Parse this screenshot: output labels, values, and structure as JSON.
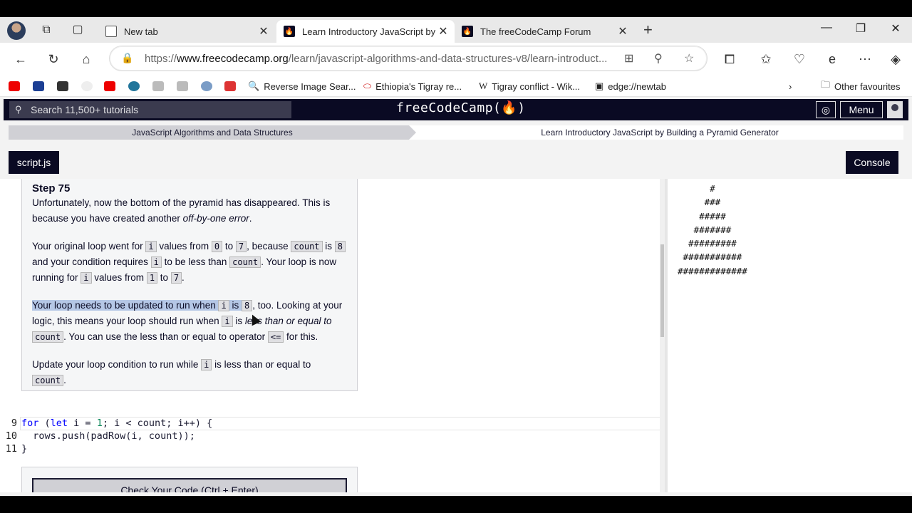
{
  "browser": {
    "tabs": [
      {
        "title": "New tab",
        "active": false
      },
      {
        "title": "Learn Introductory JavaScript by E",
        "active": true
      },
      {
        "title": "The freeCodeCamp Forum",
        "active": false
      }
    ],
    "url_prefix": "https://",
    "url_host": "www.freecodecamp.org",
    "url_path": "/learn/javascript-algorithms-and-data-structures-v8/learn-introduct...",
    "favourites": [
      {
        "label": "Reverse Image Sear...",
        "icon": "search-icon"
      },
      {
        "label": "Ethiopia's Tigray re...",
        "icon": "news-icon"
      },
      {
        "label": "Tigray conflict - Wik...",
        "icon": "wikipedia-icon"
      },
      {
        "label": "edge://newtab",
        "icon": "newtab-icon"
      }
    ],
    "other_favourites": "Other favourites",
    "colors": {
      "tab_strip": "#e9e9e9",
      "active_tab": "#ffffff"
    }
  },
  "fcc": {
    "search_placeholder": "Search 11,500+ tutorials",
    "logo": "freeCodeCamp(🔥)",
    "menu_label": "Menu",
    "breadcrumb_1": "JavaScript Algorithms and Data Structures",
    "breadcrumb_2": "Learn Introductory JavaScript by Building a Pyramid Generator",
    "file_tab": "script.js",
    "console_tab": "Console",
    "check_button": "Check Your Code (Ctrl + Enter)",
    "colors": {
      "nav": "#0a0a23",
      "panel": "#f5f6f7",
      "highlight": "#b5c7e6"
    }
  },
  "instructions": {
    "step_title": "Step 75",
    "p1_a": "Unfortunately, now the bottom of the pyramid has disappeared. This is because you have created another ",
    "p1_em": "off-by-one error",
    "p1_b": ".",
    "p2_a": "Your original loop went for ",
    "p2_b": " values from ",
    "p2_c": " to ",
    "p2_d": ", because ",
    "p2_e": " is ",
    "p2_f": " and your condition requires ",
    "p2_g": " to be less than ",
    "p2_h": ". Your loop is now running for ",
    "p2_i": " values from ",
    "p2_j": " to ",
    "p2_k": ".",
    "p3_hl": "Your loop needs to be updated to run when ",
    "p3_is": " is ",
    "p3_a": ", too. Looking at your logic, this means your loop should run when ",
    "p3_b": " is ",
    "p3_em": "less than or equal to",
    "p3_c": ". You can use the less than or equal to operator ",
    "p3_d": " for this.",
    "p4_a": "Update your loop condition to run while ",
    "p4_b": " is less than or equal to ",
    "p4_c": ".",
    "code_i": "i",
    "code_0": "0",
    "code_7": "7",
    "code_count": "count",
    "code_8": "8",
    "code_1": "1",
    "code_lte": "<="
  },
  "editor": {
    "line_numbers": [
      "9",
      "10",
      "11"
    ],
    "line1_kw": "for",
    "line1_a": " (",
    "line1_let": "let",
    "line1_b": " i = ",
    "line1_one": "1",
    "line1_c": "; i < count; i++) {",
    "line2": "  rows.push(padRow(i, count));",
    "line3": "}"
  },
  "preview": {
    "rows": [
      "      #",
      "     ###",
      "    #####",
      "   #######",
      "  #########",
      " ###########",
      "#############"
    ]
  }
}
